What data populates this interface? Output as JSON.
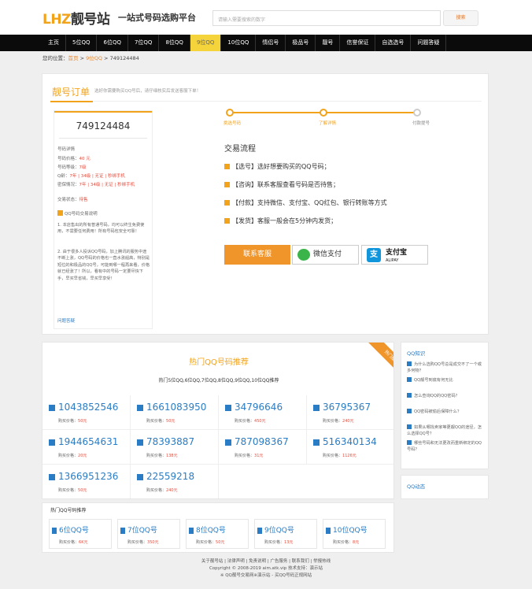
{
  "header": {
    "logo_accent": "LHZ",
    "logo_main": "靓号站",
    "slogan": "一站式号码选购平台",
    "search_placeholder": "请输入需要搜索的数字",
    "search_button": "搜索"
  },
  "nav": [
    "主页",
    "5位QQ",
    "6位QQ",
    "7位QQ",
    "8位QQ",
    "9位QQ",
    "10位QQ",
    "情侣号",
    "极品号",
    "靓号",
    "信誉保证",
    "自选选号",
    "问题答疑"
  ],
  "nav_active_index": 5,
  "breadcrumb": {
    "prefix": "您的位置：",
    "home": "首页",
    "sep1": " > ",
    "cat": "9位QQ",
    "sep2": " > ",
    "current": "749124484"
  },
  "order": {
    "title": "靓号订单",
    "subtitle": "选好你需要购买QQ号后，请仔细核实后发送客服下单！",
    "number": "749124484",
    "details_title": "号码详情",
    "details": [
      {
        "k": "号码价格：",
        "v": "40 元"
      },
      {
        "k": "号码等级：",
        "v": "7级"
      },
      {
        "k": "Q龄：",
        "v": "7年 | 34级 | 无证 | 秒绑手机"
      },
      {
        "k": "密保情况：",
        "v": "7年 | 34级 | 无证 | 秒绑手机"
      },
      {
        "k": "交易状态：",
        "v": "待售"
      }
    ],
    "notice_title": "QQ号码交易说明",
    "notices": [
      "1. 本店售出的所有普通号码，均可以终生免费使用，不需要任何费用！所有号码包安全可靠！",
      "2. 由于很多人投诉QQ号码，加上腾讯的服务中途不断上涨，QQ号码的价格也一直水涨船高，特别是短位的和极品的QQ号，可能到哪一程再来看，价格就已经涨了！所以，看有中的号码一定要尽快下手，早买早省钱，早买早享受！"
    ],
    "footer_link": "问题答疑",
    "steps": [
      "挑选号码",
      "了解详情",
      "付款提号"
    ],
    "flow_title": "交易流程",
    "flow": [
      "【选号】选好想要购买的QQ号码；",
      "【咨询】联系客服查看号码是否待售；",
      "【付款】支持微信、支付宝、QQ红包、银行转账等方式",
      "【发货】客服一般会在5分钟内发货；"
    ],
    "btn_service": "联系客服",
    "btn_wechat": "微信支付",
    "btn_alipay": "支付宝",
    "btn_alipay_sub": "ALIPAY",
    "alipay_glyph": "支"
  },
  "recommend": {
    "title": "热门QQ号码推荐",
    "subtitle": "热门5位QQ,6位QQ,7位QQ,8位QQ,9位QQ,10位QQ推荐",
    "ribbon": "热门推荐",
    "price_label": "购买价格：",
    "items": [
      {
        "num": "1043852546",
        "price": "50元"
      },
      {
        "num": "1661083950",
        "price": "50元"
      },
      {
        "num": "34796646",
        "price": "450元"
      },
      {
        "num": "36795367",
        "price": "240元"
      },
      {
        "num": "1944654631",
        "price": "20元"
      },
      {
        "num": "78393887",
        "price": "138元"
      },
      {
        "num": "787098367",
        "price": "31元"
      },
      {
        "num": "516340134",
        "price": "1126元"
      },
      {
        "num": "1366951236",
        "price": "50元"
      },
      {
        "num": "22559218",
        "price": "240元"
      }
    ]
  },
  "sidebar": {
    "title": "QQ知识",
    "items": [
      "为什么选购QQ号总是成交不了一个或多何物？",
      "QQ靓号到底有何无比",
      "怎么查询QQ的QQ密码？",
      "QQ密码被偷后保障什么？",
      "如果从哪找卖家等更靓QQ的途径，怎么选择QQ号？",
      "哪些号码和无法更改而重新绑定的QQ号码？"
    ],
    "title2": "QQ动态"
  },
  "types": {
    "title": "热门QQ号码推荐",
    "price_label": "购买价格：",
    "items": [
      {
        "name": "6位QQ号",
        "price": "6K元"
      },
      {
        "name": "7位QQ号",
        "price": "350元"
      },
      {
        "name": "8位QQ号",
        "price": "50元"
      },
      {
        "name": "9位QQ号",
        "price": "13元"
      },
      {
        "name": "10位QQ号",
        "price": "8元"
      }
    ]
  },
  "footer": {
    "line1": "关于靓号站 | 法律声明 | 免责说明 | 广告服务 | 联系我们 | 举报热线",
    "line2": "Copyright © 2008-2019 aim.atk.vip 技术支持：演示站",
    "line3": "※ QQ靓号交易网※演示站 - 买QQ号码正规网站"
  }
}
